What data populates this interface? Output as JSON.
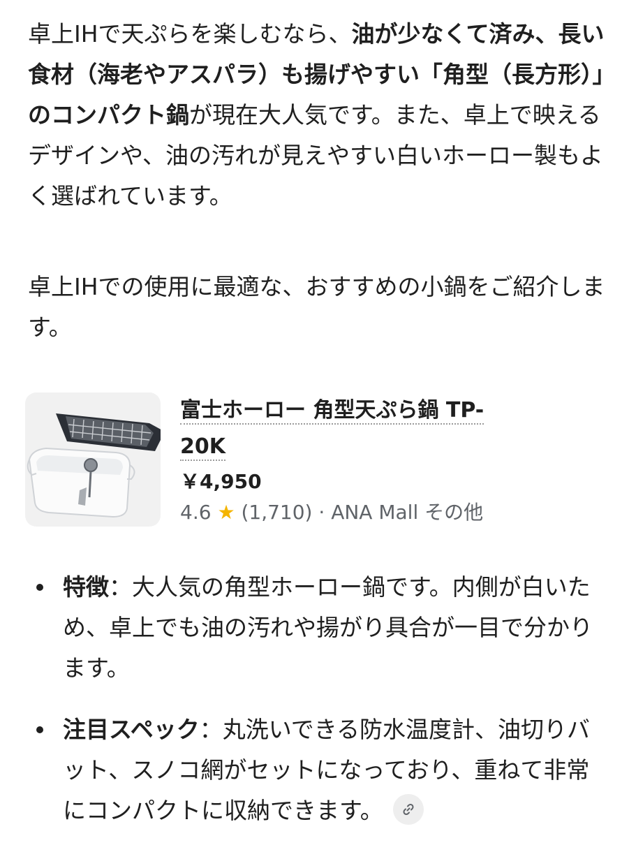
{
  "intro": {
    "p1_a": "卓上IHで天ぷらを楽しむなら、",
    "p1_b": "油が少なくて済み、長い食材（海老やアスパラ）も揚げやすい「角型（長方形）」のコンパクト鍋",
    "p1_c": "が現在大人気です。また、卓上で映えるデザインや、油の汚れが見えやすい白いホーロー製もよく選ばれています。",
    "p2": "卓上IHでの使用に最適な、おすすめの小鍋をご紹介します。"
  },
  "product": {
    "title": "富士ホーロー 角型天ぷら鍋 TP-20K",
    "price": "￥4,950",
    "rating": "4.6",
    "reviews": "(1,710)",
    "separator": "·",
    "seller": "ANA Mall その他"
  },
  "bullets": [
    {
      "label": "特徴",
      "sep": "：",
      "text": "大人気の角型ホーロー鍋です。内側が白いため、卓上でも油の汚れや揚がり具合が一目で分かります。"
    },
    {
      "label": "注目スペック",
      "sep": "：",
      "text": "丸洗いできる防水温度計、油切りバット、スノコ網がセットになっており、重ねて非常にコンパクトに収納できます。"
    }
  ],
  "icons": {
    "rating_star": "star-icon",
    "source_link": "link-icon"
  },
  "colors": {
    "star": "#f4b400",
    "muted": "#5f6368"
  }
}
